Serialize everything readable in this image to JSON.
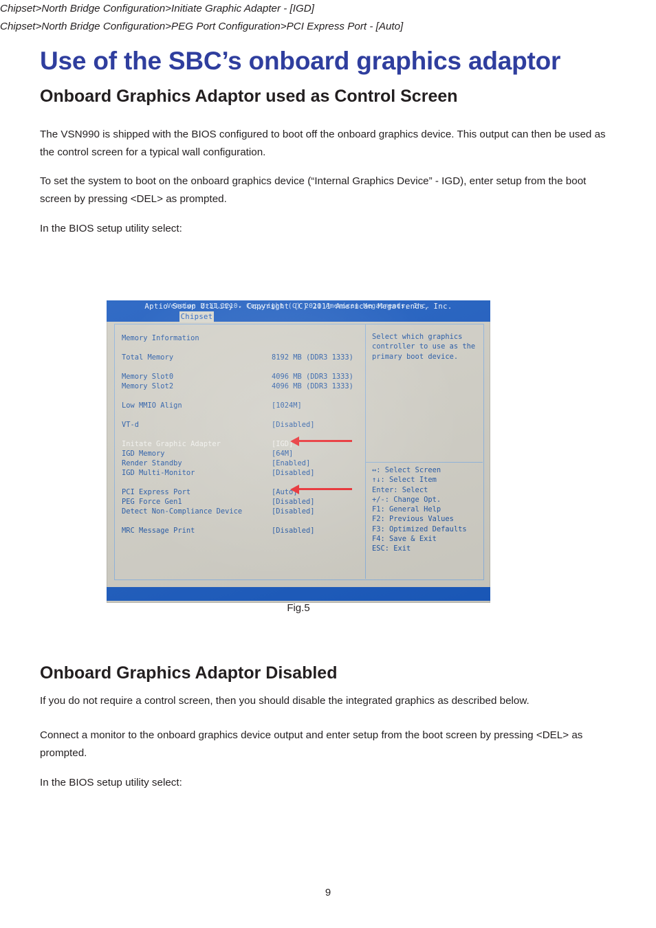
{
  "document": {
    "title": "Use of the SBC’s onboard graphics adaptor",
    "page_number": "9",
    "title_color": "#2f3e9e",
    "body_color": "#231f20"
  },
  "section_control_screen": {
    "heading": "Onboard Graphics Adaptor used as Control Screen",
    "paragraph_1": "The VSN990 is shipped with the BIOS configured to boot off the onboard graphics device.  This output can then be used as the control screen for a typical wall configuration.",
    "paragraph_2": "To set the system to boot on the onboard graphics device (“Internal Graphics Device” - IGD), enter setup from the boot screen by pressing <DEL> as prompted.",
    "paragraph_3": "In the BIOS setup utility select:",
    "path_1": "Chipset>North Bridge Configuration>Initiate Graphic Adapter - [IGD]",
    "path_2": "Chipset>North Bridge Configuration>PEG Port Configuration>PCI Express Port - [Auto]"
  },
  "figure": {
    "caption": "Fig.5",
    "bios": {
      "top_bar_title": "Aptio Setup Utility - Copyright (C) 2011 American Megatrends, Inc.",
      "active_tab": "Chipset",
      "bottom_bar_title": "Version 2.11.1210. Copyright (C) 2011 American Megatrends, Inc.",
      "rows": [
        {
          "label": "Memory Information",
          "value": ""
        },
        {
          "label": "Total Memory",
          "value": "8192 MB (DDR3 1333)"
        },
        {
          "label": "Memory Slot0",
          "value": "4096 MB (DDR3 1333)"
        },
        {
          "label": "Memory Slot2",
          "value": "4096 MB (DDR3 1333)"
        },
        {
          "label": "Low MMIO Align",
          "value": "[1024M]"
        },
        {
          "label": "VT-d",
          "value": "[Disabled]"
        },
        {
          "label": "Initate Graphic Adapter",
          "value": "[IGD]"
        },
        {
          "label": "IGD Memory",
          "value": "[64M]"
        },
        {
          "label": "Render Standby",
          "value": "[Enabled]"
        },
        {
          "label": "IGD Multi-Monitor",
          "value": "[Disabled]"
        },
        {
          "label": "PCI Express Port",
          "value": "[Auto]"
        },
        {
          "label": "PEG Force Gen1",
          "value": "[Disabled]"
        },
        {
          "label": "Detect Non-Compliance Device",
          "value": "[Disabled]"
        },
        {
          "label": "MRC Message Print",
          "value": "[Disabled]"
        }
      ],
      "help_text": [
        "Select which graphics",
        "controller to use as the",
        "primary boot device."
      ],
      "help_keys": [
        "↔: Select Screen",
        "↑↓: Select Item",
        "Enter: Select",
        "+/-: Change Opt.",
        "F1: General Help",
        "F2: Previous Values",
        "F3: Optimized Defaults",
        "F4: Save & Exit",
        "ESC: Exit"
      ],
      "annotation_color": "#ec2227"
    }
  },
  "section_disabled": {
    "heading": "Onboard Graphics Adaptor Disabled",
    "paragraph_1": "If you do not require a control screen, then you should disable the integrated graphics as described below.",
    "paragraph_2": "Connect a monitor to the onboard graphics device output and enter setup from the boot screen by pressing <DEL> as prompted.",
    "paragraph_3": "In the BIOS setup utility select:"
  }
}
